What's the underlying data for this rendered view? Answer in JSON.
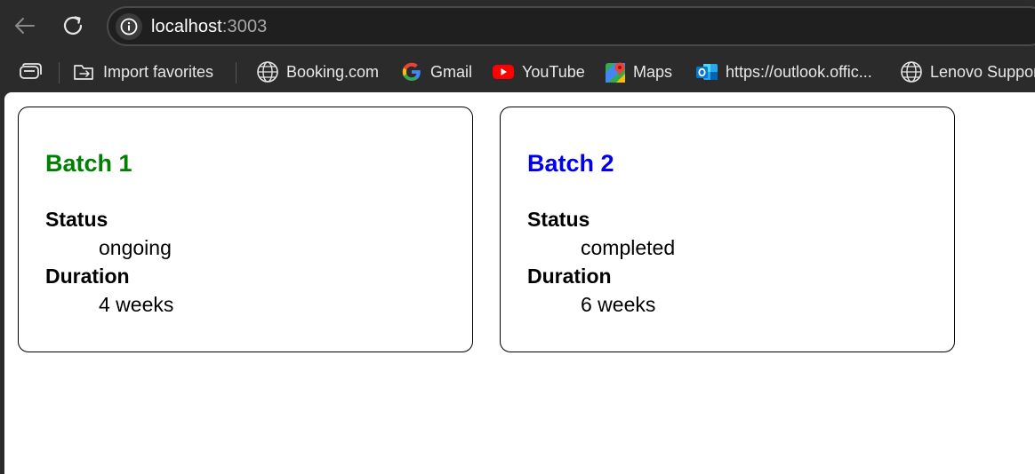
{
  "browser": {
    "url_host": "localhost",
    "url_port": ":3003",
    "bookmarks": [
      {
        "label": "Import favorites",
        "icon": "import-favorites-icon"
      },
      {
        "label": "Booking.com",
        "icon": "globe-icon"
      },
      {
        "label": "Gmail",
        "icon": "google-icon"
      },
      {
        "label": "YouTube",
        "icon": "youtube-icon"
      },
      {
        "label": "Maps",
        "icon": "maps-icon"
      },
      {
        "label": "https://outlook.offic...",
        "icon": "outlook-icon"
      },
      {
        "label": "Lenovo Support",
        "icon": "globe-icon"
      }
    ]
  },
  "batches": [
    {
      "title": "Batch 1",
      "title_color": "#008000",
      "status_label": "Status",
      "status": "ongoing",
      "duration_label": "Duration",
      "duration": "4 weeks"
    },
    {
      "title": "Batch 2",
      "title_color": "#0000ee",
      "status_label": "Status",
      "status": "completed",
      "duration_label": "Duration",
      "duration": "6 weeks"
    }
  ]
}
